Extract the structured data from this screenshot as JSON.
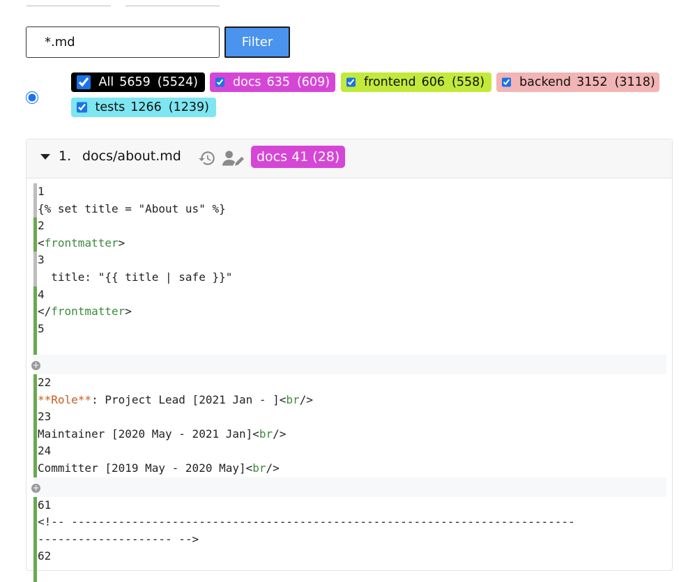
{
  "filter": {
    "value": "*.md",
    "button_label": "Filter"
  },
  "groups": [
    {
      "name": "All",
      "count": "5659",
      "sub": "(5524)",
      "bg": "#000000",
      "fg": "#ffffff"
    },
    {
      "name": "docs",
      "count": "635",
      "sub": "(609)",
      "bg": "#d646d6",
      "fg": "#ffffff"
    },
    {
      "name": "frontend",
      "count": "606",
      "sub": "(558)",
      "bg": "#c2ea3a",
      "fg": "#111111"
    },
    {
      "name": "backend",
      "count": "3152",
      "sub": "(3118)",
      "bg": "#f2b4b4",
      "fg": "#111111"
    },
    {
      "name": "tests",
      "count": "1266",
      "sub": "(1239)",
      "bg": "#7ee6f0",
      "fg": "#111111"
    }
  ],
  "file": {
    "index": "1.",
    "path": "docs/about.md",
    "badge": "docs 41 (28)"
  },
  "hunks": [
    {
      "lines": [
        {
          "num": "1",
          "parts": [
            {
              "t": "{% set title = \"About us\" %}"
            }
          ],
          "status": "gray"
        },
        {
          "num": "2",
          "parts": [
            {
              "t": "<"
            },
            {
              "t": "frontmatter",
              "c": "tag"
            },
            {
              "t": ">"
            }
          ],
          "status": "green"
        },
        {
          "num": "3",
          "parts": [
            {
              "t": "  title: \"{{ title | safe }}\""
            }
          ],
          "status": "gray"
        },
        {
          "num": "4",
          "parts": [
            {
              "t": "</"
            },
            {
              "t": "frontmatter",
              "c": "tag"
            },
            {
              "t": ">"
            }
          ],
          "status": "green"
        },
        {
          "num": "5",
          "parts": [
            {
              "t": ""
            }
          ],
          "status": "green"
        }
      ]
    },
    {
      "lines": [
        {
          "num": "22",
          "parts": [
            {
              "t": "**Role**",
              "c": "md"
            },
            {
              "t": ": Project Lead [2021 Jan - ]<"
            },
            {
              "t": "br",
              "c": "tag"
            },
            {
              "t": "/>"
            }
          ],
          "status": "green"
        },
        {
          "num": "23",
          "parts": [
            {
              "t": "Maintainer [2020 May - 2021 Jan]<"
            },
            {
              "t": "br",
              "c": "tag"
            },
            {
              "t": "/>"
            }
          ],
          "status": "green"
        },
        {
          "num": "24",
          "parts": [
            {
              "t": "Committer [2019 May - 2020 May]<"
            },
            {
              "t": "br",
              "c": "tag"
            },
            {
              "t": "/>"
            }
          ],
          "status": "green"
        }
      ]
    },
    {
      "lines": [
        {
          "num": "61",
          "parts": [
            {
              "t": "<!-- ---------------------------------------------------------------------------"
            }
          ],
          "status": "green"
        },
        {
          "num": "",
          "parts": [
            {
              "t": "-------------------- -->"
            }
          ],
          "status": "green"
        },
        {
          "num": "62",
          "parts": [
            {
              "t": ""
            }
          ],
          "status": "green"
        }
      ]
    }
  ],
  "icons": {
    "history": "history-icon",
    "user": "user-edit-icon",
    "expand": "plus-circle-icon"
  }
}
